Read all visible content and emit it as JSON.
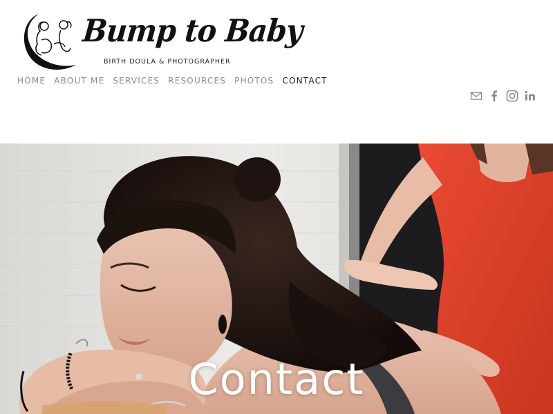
{
  "brand": {
    "name": "Bump to Baby",
    "tagline": "BIRTH DOULA & PHOTOGRAPHER"
  },
  "nav": {
    "items": [
      {
        "label": "HOME"
      },
      {
        "label": "ABOUT ME"
      },
      {
        "label": "SERVICES"
      },
      {
        "label": "RESOURCES"
      },
      {
        "label": "PHOTOS"
      },
      {
        "label": "CONTACT"
      }
    ],
    "active_index": 5
  },
  "social": {
    "icons": [
      "mail-icon",
      "facebook-icon",
      "instagram-icon",
      "linkedin-icon"
    ],
    "color": "#8a8a8a"
  },
  "hero": {
    "title": "Contact",
    "image_description_icon": "photo-pregnancy-massage"
  },
  "colors": {
    "nav_inactive": "#8a8a8a",
    "nav_active": "#1a1a1a",
    "hero_text": "#ffffff",
    "shirt_red": "#e2452f"
  }
}
